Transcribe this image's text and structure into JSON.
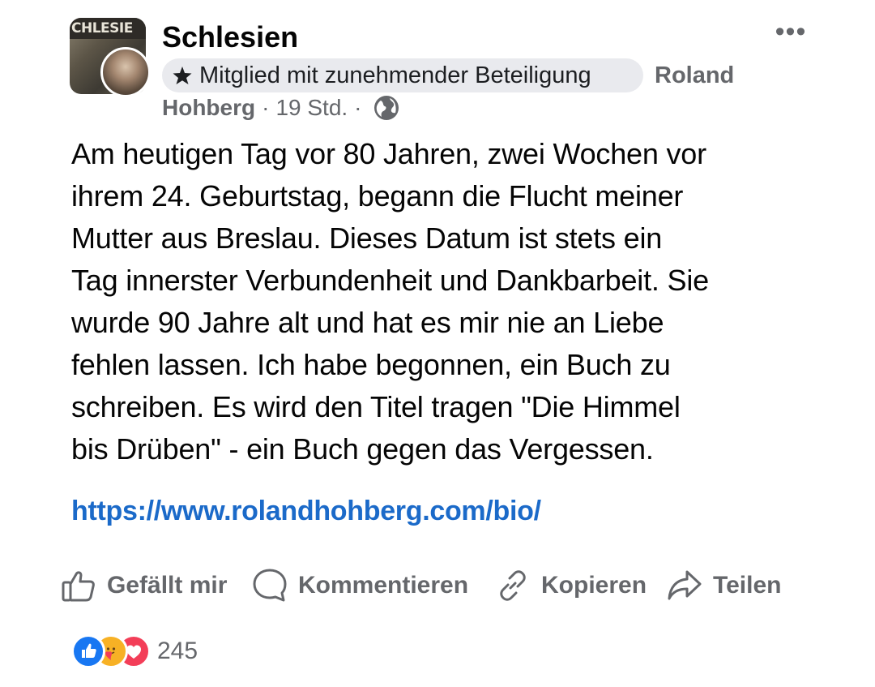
{
  "post": {
    "group_name": "Schlesien",
    "group_avatar_text": "CHLESIE",
    "badge_label": "Mitglied mit zunehmender Beteiligung",
    "author_first": "Roland",
    "author_last": "Hohberg",
    "separator": "·",
    "time": "19 Std.",
    "privacy_icon": "globe-icon",
    "more_label": "•••",
    "text_lines": [
      "Am heutigen Tag vor 80 Jahren, zwei Wochen vor",
      "ihrem 24. Geburtstag, begann die Flucht meiner",
      "Mutter aus Breslau. Dieses Datum ist stets ein",
      "Tag innerster Verbundenheit und Dankbarbeit. Sie",
      "wurde 90 Jahre alt und hat es mir nie an Liebe",
      "fehlen lassen. Ich habe begonnen, ein Buch zu",
      "schreiben. Es wird den Titel tragen \"Die Himmel",
      "bis Drüben\" - ein Buch gegen das Vergessen."
    ],
    "link": "https://www.rolandhohberg.com/bio/"
  },
  "actions": {
    "like": "Gefällt mir",
    "comment": "Kommentieren",
    "copy": "Kopieren",
    "share": "Teilen"
  },
  "reactions": {
    "types": [
      "like-icon",
      "care-icon",
      "love-icon"
    ],
    "count": "245"
  },
  "colors": {
    "link": "#1b6ac9",
    "muted": "#65676b",
    "badge_bg": "#e9eaee",
    "like": "#1877f2",
    "care": "#f7b125",
    "love": "#f33e58"
  }
}
